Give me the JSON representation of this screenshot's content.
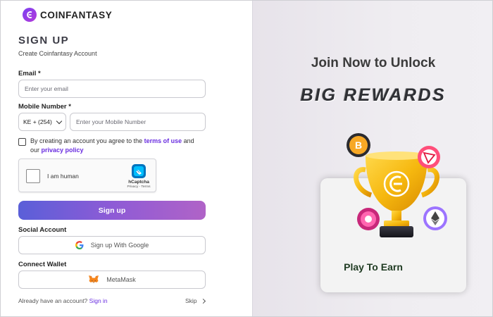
{
  "brand": {
    "name": "COINFANTASY"
  },
  "form": {
    "title": "SIGN UP",
    "subtitle": "Create Coinfantasy Account",
    "email_label": "Email *",
    "email_placeholder": "Enter your email",
    "mobile_label": "Mobile Number *",
    "country_code": "KE + (254)",
    "mobile_placeholder": "Enter your Mobile Number",
    "agree_prefix": "By creating an account you agree to the",
    "terms_link": "terms of use",
    "agree_and": "and",
    "agree_our": "our",
    "privacy_link": "privacy policy",
    "signup_button": "Sign up"
  },
  "captcha": {
    "label": "I am human",
    "brand": "hCaptcha",
    "links": "Privacy - Terms"
  },
  "social": {
    "heading": "Social Account",
    "google_button": "Sign up With Google"
  },
  "wallet": {
    "heading": "Connect Wallet",
    "metamask_button": "MetaMask"
  },
  "footer": {
    "have_account": "Already have an account?",
    "signin_link": "Sign in",
    "skip": "Skip"
  },
  "promo": {
    "line1": "Join Now to Unlock",
    "line2": "BIG REWARDS",
    "card_label": "Play To Earn"
  },
  "colors": {
    "accent": "#6a2ee0",
    "button_gradient_start": "#5a5fd8",
    "button_gradient_end": "#b063c7"
  }
}
